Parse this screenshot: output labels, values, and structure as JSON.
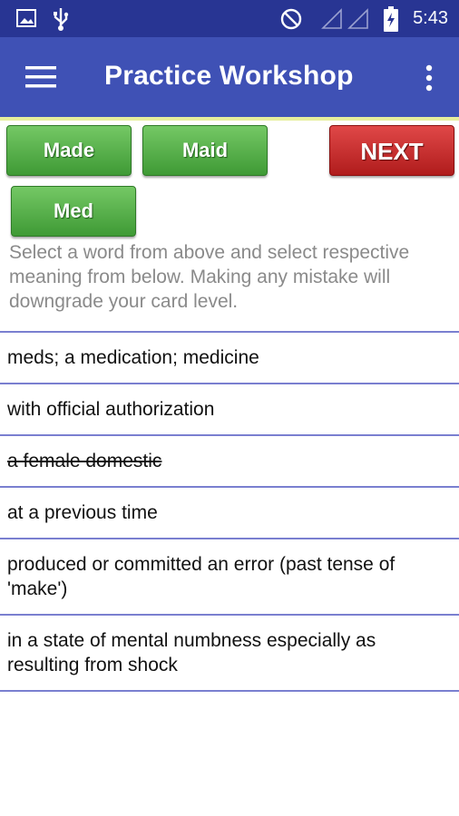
{
  "status_bar": {
    "time": "5:43",
    "icons": [
      "image-icon",
      "usb-icon",
      "do-not-disturb-icon",
      "signal-icon",
      "signal-icon",
      "battery-charging-icon"
    ]
  },
  "app_bar": {
    "title": "Practice Workshop",
    "menu_icon": "hamburger-menu-icon",
    "overflow_icon": "more-vert-icon"
  },
  "word_buttons": [
    {
      "label": "Made"
    },
    {
      "label": "Maid"
    },
    {
      "label": "Med"
    }
  ],
  "next_button": {
    "label": "NEXT"
  },
  "instructions": "Select a word from above and select respective meaning from below. Making any mistake will downgrade your card level.",
  "meanings": [
    {
      "text": "meds; a medication; medicine",
      "struck": false
    },
    {
      "text": "with official authorization",
      "struck": false
    },
    {
      "text": "a female domestic",
      "struck": true
    },
    {
      "text": "at a previous time",
      "struck": false
    },
    {
      "text": "produced or committed an error (past tense of 'make')",
      "struck": false
    },
    {
      "text": "in a state of mental numbness especially as resulting from shock",
      "struck": false
    }
  ],
  "colors": {
    "status_bar": "#283593",
    "app_bar": "#3f51b5",
    "word_button": "#4caf50",
    "next_button": "#c62828",
    "separator": "#7a7fd0"
  }
}
